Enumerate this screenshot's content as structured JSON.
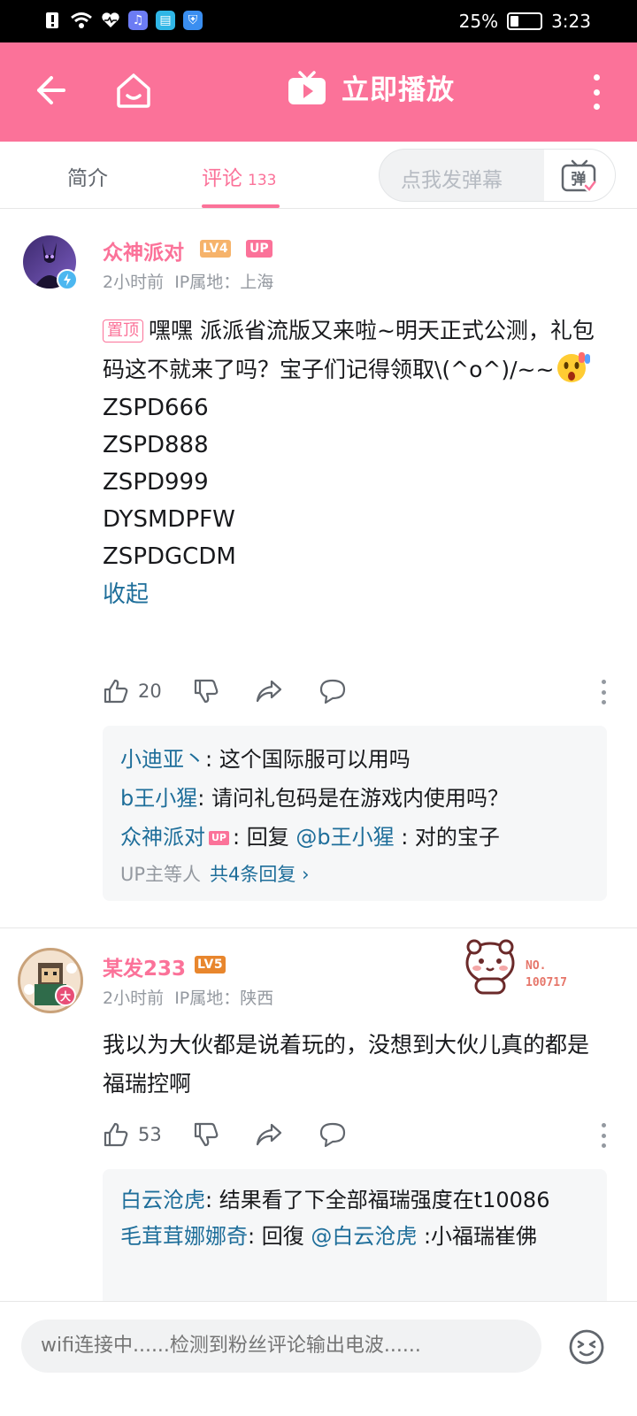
{
  "status_bar": {
    "battery": "25%",
    "time": "3:23",
    "battery_level": 0.25
  },
  "app_bar": {
    "title": "立即播放"
  },
  "tabs": {
    "intro_label": "简介",
    "comment_label": "评论",
    "comment_count": "133",
    "danmaku_placeholder": "点我发弹幕",
    "danmaku_button": "弹"
  },
  "comments": [
    {
      "username": "众神派对",
      "level": "LV4",
      "up_badge": "UP",
      "time": "2小时前",
      "ip": "IP属地：上海",
      "pin_label": "置顶",
      "text": "嘿嘿 派派省流版又来啦~明天正式公测，礼包码这不就来了吗？宝子们记得领取\\(^o^)/~~",
      "codes": [
        "ZSPD666",
        "ZSPD888",
        "ZSPD999",
        "DYSMDPFW",
        "ZSPDGCDM"
      ],
      "collapse_label": "收起",
      "likes": "20",
      "replies": [
        {
          "name": "小迪亚丶",
          "text": ": 这个国际服可以用吗"
        },
        {
          "name": "b王小猩",
          "text": ": 请问礼包码是在游戏内使用吗？"
        },
        {
          "name": "众神派对",
          "up_tag": "UP",
          "text_prefix": ": 回复 ",
          "mention": "@b王小猩",
          "text": " : 对的宝子"
        }
      ],
      "reply_footer": {
        "who": "UP主等人",
        "total": "共4条回复",
        "arrow": "›"
      }
    },
    {
      "username": "某发233",
      "level": "LV5",
      "avatar_badge": "大",
      "time": "2小时前",
      "ip": "IP属地：陕西",
      "fan_badge": {
        "label": "NO.",
        "number": "100717"
      },
      "text": "我以为大伙都是说着玩的，没想到大伙儿真的都是福瑞控啊",
      "likes": "53",
      "replies": [
        {
          "name": "白云沧虎",
          "text": ": 结果看了下全部福瑞强度在t10086"
        },
        {
          "name": "毛茸茸娜娜奇",
          "text_prefix": ": 回復 ",
          "mention": "@白云沧虎",
          "text": " :小福瑞崔佛"
        }
      ]
    }
  ],
  "bottom_bar": {
    "placeholder": "wifi连接中......检测到粉丝评论输出电波......"
  },
  "colors": {
    "brand_pink": "#fb7299",
    "link_blue": "#1e6e9a",
    "lv4": "#f6b36b",
    "lv5": "#e8862d"
  }
}
